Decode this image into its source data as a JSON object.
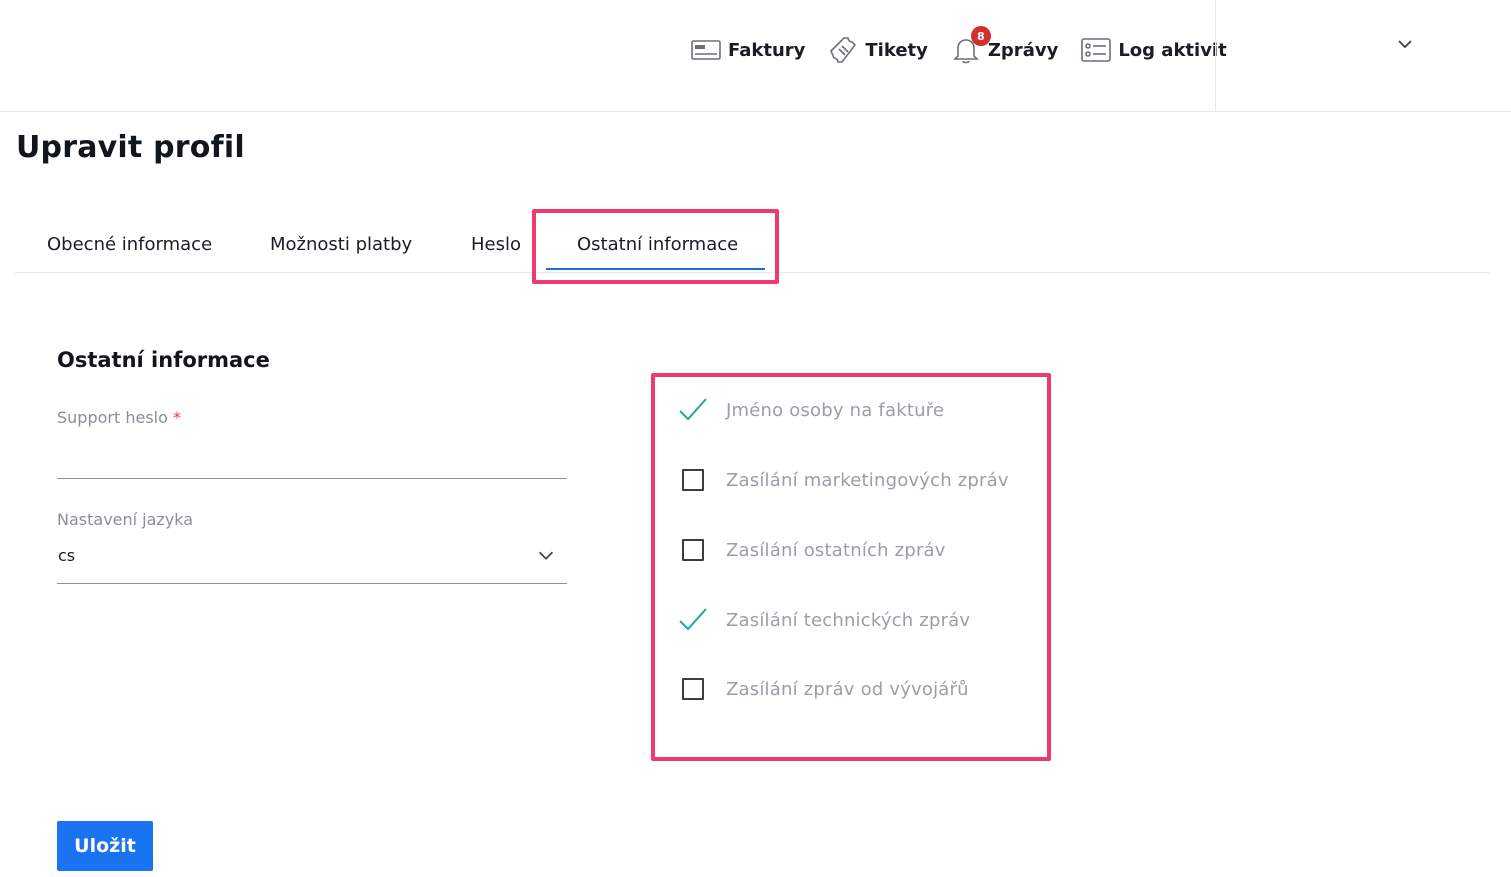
{
  "header": {
    "nav": [
      {
        "label": "Faktury",
        "icon": "invoice-icon"
      },
      {
        "label": "Tikety",
        "icon": "ticket-icon"
      },
      {
        "label": "Zprávy",
        "icon": "bell-icon",
        "badge": "8"
      },
      {
        "label": "Log aktivit",
        "icon": "activity-log-icon"
      }
    ],
    "user_menu_icon": "chevron-down-icon"
  },
  "page": {
    "title": "Upravit profil"
  },
  "tabs": [
    {
      "label": "Obecné informace",
      "active": false
    },
    {
      "label": "Možnosti platby",
      "active": false
    },
    {
      "label": "Heslo",
      "active": false
    },
    {
      "label": "Ostatní informace",
      "active": true
    }
  ],
  "section": {
    "title": "Ostatní informace",
    "support_password": {
      "label": "Support heslo",
      "required_mark": "*",
      "value": ""
    },
    "language": {
      "label": "Nastavení jazyka",
      "value": "cs"
    }
  },
  "checkboxes": [
    {
      "label": "Jméno osoby na faktuře",
      "checked": true
    },
    {
      "label": "Zasílání marketingových zpráv",
      "checked": false
    },
    {
      "label": "Zasílání ostatních zpráv",
      "checked": false
    },
    {
      "label": "Zasílání technických zpráv",
      "checked": true
    },
    {
      "label": "Zasílání zpráv od vývojářů",
      "checked": false
    }
  ],
  "actions": {
    "save_label": "Uložit"
  },
  "colors": {
    "accent": "#1a73f0",
    "highlight": "#ee3a6c",
    "check": "#26a69a",
    "badge": "#d32f2f"
  }
}
